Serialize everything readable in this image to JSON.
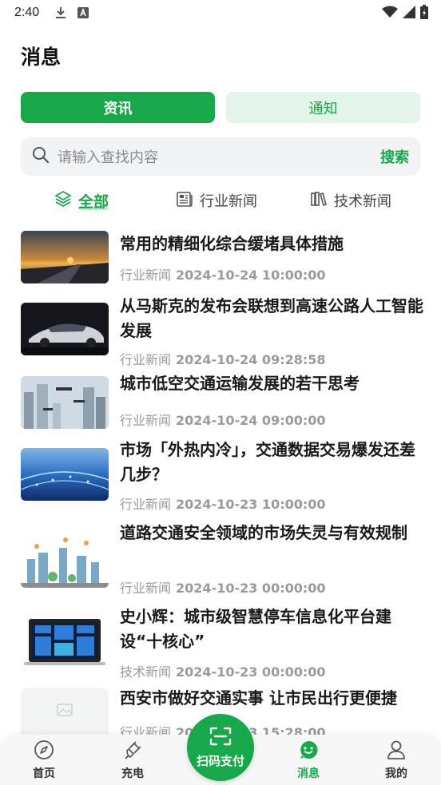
{
  "status_bar": {
    "time": "2:40"
  },
  "page": {
    "title": "消息"
  },
  "segments": {
    "active": "资讯",
    "inactive": "通知"
  },
  "search": {
    "placeholder": "请输入查找内容",
    "button": "搜索"
  },
  "categories": [
    {
      "label": "全部",
      "icon": "layers-icon"
    },
    {
      "label": "行业新闻",
      "icon": "newspaper-icon"
    },
    {
      "label": "技术新闻",
      "icon": "books-icon"
    }
  ],
  "news": [
    {
      "title": "常用的精细化综合缓堵具体措施",
      "category": "行业新闻",
      "date": "2024-10-24 10:00:00"
    },
    {
      "title": "从马斯克的发布会联想到高速公路人工智能发展",
      "category": "行业新闻",
      "date": "2024-10-24 09:28:58"
    },
    {
      "title": "城市低空交通运输发展的若干思考",
      "category": "行业新闻",
      "date": "2024-10-24 09:00:00"
    },
    {
      "title": "市场「外热内冷」，交通数据交易爆发还差几步？",
      "category": "行业新闻",
      "date": "2024-10-23 10:00:00"
    },
    {
      "title": "道路交通安全领域的市场失灵与有效规制",
      "category": "行业新闻",
      "date": "2024-10-23 00:00:00"
    },
    {
      "title": "史小辉：城市级智慧停车信息化平台建设“十核心”",
      "category": "技术新闻",
      "date": "2024-10-23 00:00:00"
    },
    {
      "title": "西安市做好交通实事 让市民出行更便捷",
      "category": "行业新闻",
      "date": "2024-10-23 15:28:00",
      "date_visible": "20",
      "time_visible": "15:28:00"
    }
  ],
  "bottom_nav": {
    "home": "首页",
    "charge": "充电",
    "scan": "扫码支付",
    "messages": "消息",
    "mine": "我的"
  },
  "colors": {
    "accent": "#17a84a",
    "accent_light": "#e3f5e8"
  }
}
